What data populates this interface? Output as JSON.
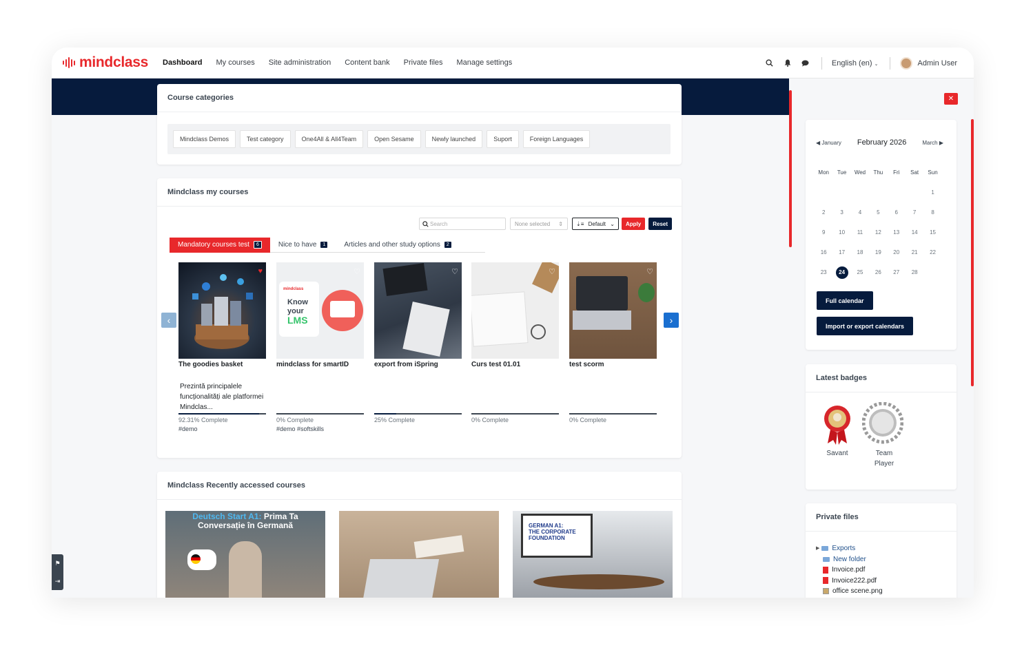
{
  "brand": {
    "name": "mindclass"
  },
  "nav": {
    "items": [
      "Dashboard",
      "My courses",
      "Site administration",
      "Content bank",
      "Private files",
      "Manage settings"
    ],
    "language": "English (en)",
    "user": "Admin User"
  },
  "categories": {
    "title": "Course categories",
    "items": [
      "Mindclass Demos",
      "Test category",
      "One4All & All4Team",
      "Open Sesame",
      "Newly launched",
      "Suport",
      "Foreign Languages"
    ]
  },
  "my_courses": {
    "title": "Mindclass my courses",
    "search_placeholder": "Search",
    "selected_filter": "None selected",
    "sort": "Default",
    "apply": "Apply",
    "reset": "Reset",
    "tabs": [
      {
        "label": "Mandatory courses test",
        "count": "6"
      },
      {
        "label": "Nice to have",
        "count": "1"
      },
      {
        "label": "Articles and other study options",
        "count": "2"
      }
    ],
    "courses": [
      {
        "name": "The goodies basket",
        "desc": "Prezintă principalele funcționalități ale platformei Mindclas...",
        "progress_text": "92.31% Complete",
        "progress": 92.31,
        "tags": "#demo",
        "favorite": true
      },
      {
        "name": "mindclass for smartID",
        "desc": "",
        "progress_text": "0% Complete",
        "progress": 0,
        "tags": "#demo #softskills",
        "favorite": false
      },
      {
        "name": "export from iSpring",
        "desc": "",
        "progress_text": "25% Complete",
        "progress": 25,
        "tags": "",
        "favorite": false
      },
      {
        "name": "Curs test 01.01",
        "desc": "",
        "progress_text": "0% Complete",
        "progress": 0,
        "tags": "",
        "favorite": false
      },
      {
        "name": "test scorm",
        "desc": "",
        "progress_text": "0% Complete",
        "progress": 0,
        "tags": "",
        "favorite": false
      }
    ],
    "lms_card": {
      "brand": "mindclass",
      "line1": "Know",
      "line2": "your",
      "line3": "LMS"
    }
  },
  "recent": {
    "title": "Mindclass Recently accessed courses",
    "banner1": {
      "title_a": "Deutsch Start A1:",
      "title_b": "Prima Ta",
      "title_c": "Conversație în Germană"
    },
    "banner3": {
      "line1": "GERMAN A1:",
      "line2": "THE CORPORATE",
      "line3": "FOUNDATION"
    }
  },
  "calendar": {
    "prev": "January",
    "current": "February 2026",
    "next": "March",
    "weekdays": [
      "Mon",
      "Tue",
      "Wed",
      "Thu",
      "Fri",
      "Sat",
      "Sun"
    ],
    "weeks": [
      [
        "",
        "",
        "",
        "",
        "",
        "",
        "1"
      ],
      [
        "2",
        "3",
        "4",
        "5",
        "6",
        "7",
        "8"
      ],
      [
        "9",
        "10",
        "11",
        "12",
        "13",
        "14",
        "15"
      ],
      [
        "16",
        "17",
        "18",
        "19",
        "20",
        "21",
        "22"
      ],
      [
        "23",
        "24",
        "25",
        "26",
        "27",
        "28",
        ""
      ]
    ],
    "today": "24",
    "full_calendar": "Full calendar",
    "import_export": "Import or export calendars"
  },
  "badges": {
    "title": "Latest badges",
    "items": [
      {
        "name": "Savant"
      },
      {
        "name": "Team Player"
      }
    ]
  },
  "private_files": {
    "title": "Private files",
    "items": [
      {
        "name": "Exports",
        "type": "folder"
      },
      {
        "name": "New folder",
        "type": "folder"
      },
      {
        "name": "Invoice.pdf",
        "type": "pdf"
      },
      {
        "name": "Invoice222.pdf",
        "type": "pdf"
      },
      {
        "name": "office scene.png",
        "type": "image"
      }
    ]
  },
  "colors": {
    "accent": "#e8282b",
    "navy": "#061b3d"
  }
}
